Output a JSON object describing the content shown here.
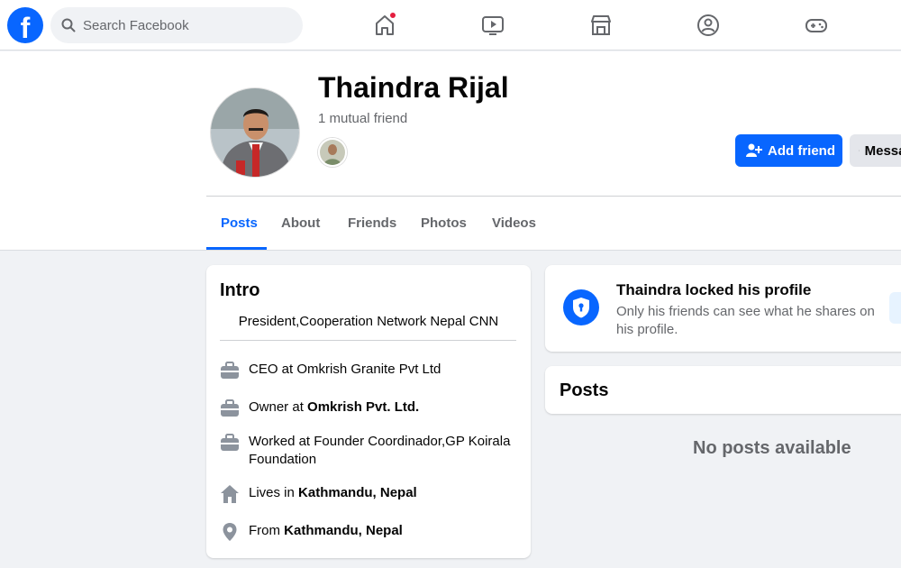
{
  "nav": {
    "logo": "f",
    "search_placeholder": "Search Facebook"
  },
  "profile": {
    "name": "Thaindra Rijal",
    "mutual": "1 mutual friend",
    "add_friend_label": "Add friend",
    "message_label": "Message"
  },
  "tabs": [
    {
      "label": "Posts",
      "active": true
    },
    {
      "label": "About"
    },
    {
      "label": "Friends"
    },
    {
      "label": "Photos"
    },
    {
      "label": "Videos"
    }
  ],
  "intro": {
    "title": "Intro",
    "bio": "President,Cooperation Network Nepal CNN",
    "items": [
      {
        "icon": "briefcase-icon",
        "prefix": "CEO at Omkrish Granite Pvt Ltd",
        "bold": ""
      },
      {
        "icon": "briefcase-icon",
        "prefix": "Owner at ",
        "bold": "Omkrish Pvt. Ltd."
      },
      {
        "icon": "briefcase-icon",
        "prefix": "Worked at Founder Coordinador,GP Koirala Foundation",
        "bold": ""
      },
      {
        "icon": "home-icon",
        "prefix": "Lives in ",
        "bold": "Kathmandu, Nepal"
      },
      {
        "icon": "location-pin-icon",
        "prefix": "From ",
        "bold": "Kathmandu, Nepal"
      }
    ]
  },
  "locked": {
    "title": "Thaindra locked his profile",
    "subtitle": "Only his friends can see what he shares on his profile."
  },
  "posts": {
    "title": "Posts",
    "empty": "No posts available"
  },
  "colors": {
    "brand": "#0866ff",
    "notification": "#e41e3f"
  }
}
